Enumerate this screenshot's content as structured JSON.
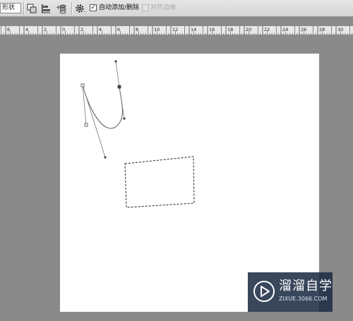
{
  "options_bar": {
    "shape_mode_value": "形状",
    "icons": [
      "path-ops-icon",
      "align-icon",
      "arrange-icon",
      "gear-icon"
    ],
    "auto_add_delete": {
      "label": "自动添加/删除",
      "checked": true
    },
    "align_edges": {
      "label": "对齐边缘",
      "checked": false,
      "enabled": false
    }
  },
  "ruler": {
    "labels": [
      "6",
      "4",
      "2",
      "0",
      "2",
      "4",
      "6",
      "8",
      "10",
      "12",
      "14",
      "16",
      "18",
      "20",
      "22",
      "24",
      "26",
      "28",
      "30"
    ]
  },
  "watermark": {
    "brand": "溜溜自学",
    "url": "ZIXUE.3066.COM"
  }
}
